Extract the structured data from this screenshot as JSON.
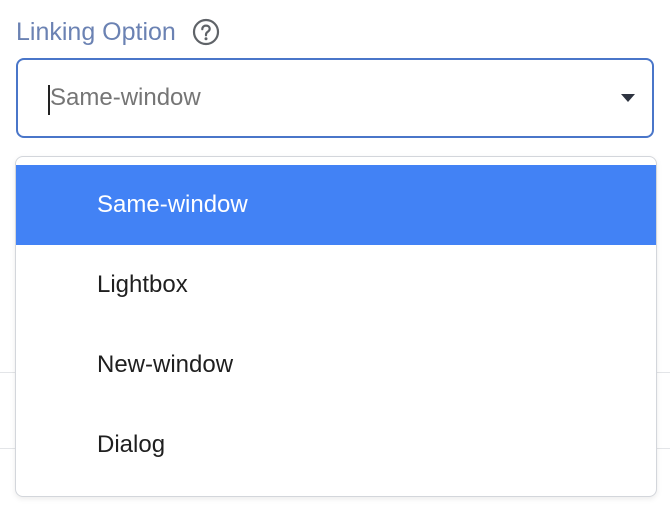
{
  "field": {
    "label": "Linking Option",
    "help_icon": "question-circle-icon"
  },
  "select": {
    "value": "Same-window",
    "arrow_icon": "triangle-down-icon"
  },
  "menu": {
    "items": [
      {
        "label": "Same-window",
        "selected": true
      },
      {
        "label": "Lightbox",
        "selected": false
      },
      {
        "label": "New-window",
        "selected": false
      },
      {
        "label": "Dialog",
        "selected": false
      }
    ]
  },
  "colors": {
    "label": "#6b82b3",
    "focus_border": "#4a76c9",
    "selected_bg": "#4282f5",
    "selected_text": "#ffffff"
  }
}
